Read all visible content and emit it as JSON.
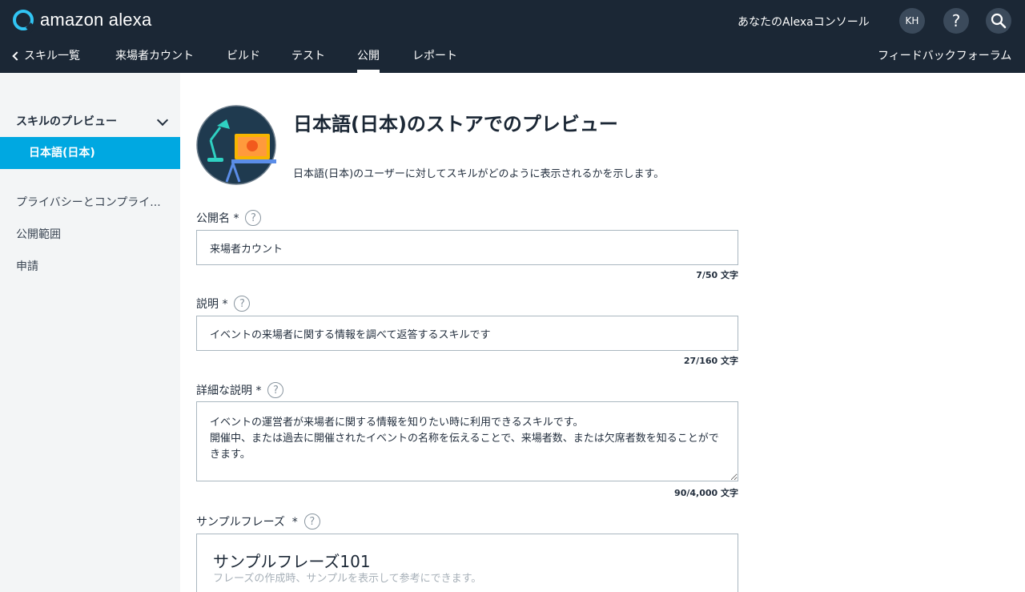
{
  "header": {
    "logo_text": "amazon alexa",
    "console_label": "あなたのAlexaコンソール",
    "avatar_initials": "KH",
    "help_label": "?",
    "search_icon": "search-icon",
    "colors": {
      "bar": "#1b2735",
      "accent": "#00a8e1",
      "logo_ring": "#31c4f3"
    }
  },
  "nav": {
    "back_label": "スキル一覧",
    "items": [
      {
        "label": "来場者カウント"
      },
      {
        "label": "ビルド"
      },
      {
        "label": "テスト"
      },
      {
        "label": "公開",
        "active": true
      },
      {
        "label": "レポート"
      }
    ],
    "feedback_label": "フィードバックフォーラム"
  },
  "sidebar": {
    "section_label": "スキルのプレビュー",
    "active_item": "日本語(日本)",
    "items": [
      {
        "label": "プライバシーとコンプライ..."
      },
      {
        "label": "公開範囲"
      },
      {
        "label": "申請"
      }
    ]
  },
  "main": {
    "title": "日本語(日本)のストアでのプレビュー",
    "subtitle": "日本語(日本)のユーザーに対してスキルがどのように表示されるかを示します。",
    "fields": {
      "public_name": {
        "label": "公開名 *",
        "value": "来場者カウント",
        "counter": "7/50 文字"
      },
      "description": {
        "label": "説明 *",
        "value": "イベントの来場者に関する情報を調べて返答するスキルです",
        "counter": "27/160 文字"
      },
      "detailed_description": {
        "label": "詳細な説明 *",
        "value": "イベントの運営者が来場者に関する情報を知りたい時に利用できるスキルです。\n開催中、または過去に開催されたイベントの名称を伝えることで、来場者数、または欠席者数を知ることができます。",
        "counter": "90/4,000 文字"
      },
      "sample_phrases": {
        "label": "サンプルフレーズ  *",
        "box_title": "サンプルフレーズ101",
        "box_hint": "フレーズの作成時、サンプルを表示して参考にできます。"
      }
    }
  }
}
